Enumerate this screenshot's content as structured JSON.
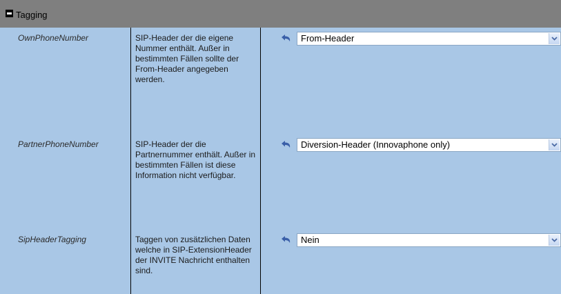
{
  "section": {
    "title": "Tagging"
  },
  "rows": [
    {
      "name": "OwnPhoneNumber",
      "description": "SIP-Header der die eigene Nummer enthält. Außer in bestimmten Fällen sollte der From-Header angegeben werden.",
      "value": "From-Header"
    },
    {
      "name": "PartnerPhoneNumber",
      "description": "SIP-Header der die Partnernummer enthält. Außer in bestimmten Fällen ist diese Information nicht verfügbar.",
      "value": "Diversion-Header (Innovaphone only)"
    },
    {
      "name": "SipHeaderTagging",
      "description": "Taggen von zusätzlichen Daten welche in SIP-ExtensionHeader der INVITE Nachricht enthalten sind.",
      "value": "Nein"
    }
  ],
  "icons": {
    "collapse": "minus-box-icon",
    "reset": "undo-arrow-icon",
    "dropdown": "chevron-down-icon"
  },
  "colors": {
    "panel": "#a9c7e6",
    "header": "#7f7f7f",
    "arrow": "#3a5fa8"
  }
}
